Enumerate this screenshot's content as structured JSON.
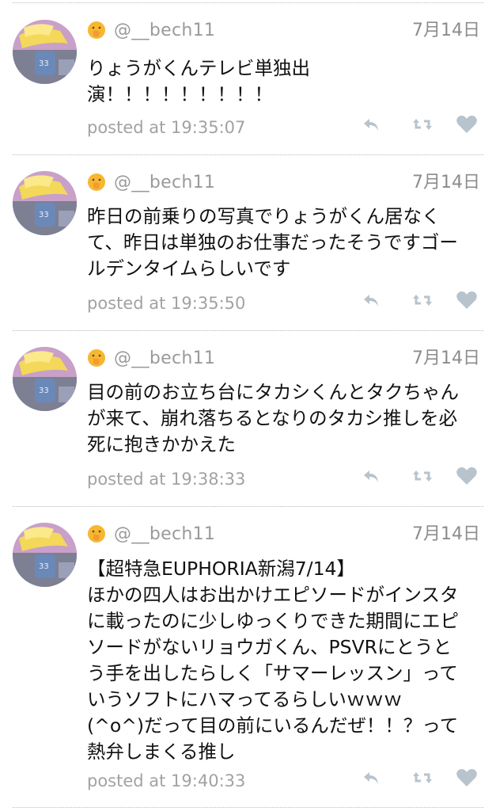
{
  "tweets": [
    {
      "username": "@__bech11",
      "date": "7月14日",
      "text": "りょうがくんテレビ単独出\n演！！！！！！！！！",
      "posted": "posted at 19:35:07"
    },
    {
      "username": "@__bech11",
      "date": "7月14日",
      "text": "昨日の前乗りの写真でりょうがくん居なく\nて、昨日は単独のお仕事だったそうですゴー\nルデンタイムらしいです",
      "posted": "posted at 19:35:50"
    },
    {
      "username": "@__bech11",
      "date": "7月14日",
      "text": "目の前のお立ち台にタカシくんとタクちゃん\nが来て、崩れ落ちるとなりのタカシ推しを必\n死に抱きかかえた",
      "posted": "posted at 19:38:33"
    },
    {
      "username": "@__bech11",
      "date": "7月14日",
      "text": "【超特急EUPHORIA新潟7/14】\nほかの四人はお出かけエピソードがインスタ\nに載ったのに少しゆっくりできた期間にエピ\nソードがないリョウガくん、PSVRにとうと\nう手を出したらしく「サマーレッスン」って\nいうソフトにハマってるらしいｗｗｗ\n(^o^)だって目の前にいるんだぜ！！？って\n熱弁しまくる推し",
      "posted": "posted at 19:40:33"
    }
  ],
  "icons": {
    "avatar": "user-avatar",
    "emoji": "hand-over-mouth-emoji-icon",
    "reply": "reply-icon",
    "retweet": "retweet-icon",
    "like": "heart-icon"
  },
  "colors": {
    "text": "#111111",
    "muted": "#a2a2a2",
    "icon": "#b8c3cc",
    "divider": "#b9b9b9"
  }
}
